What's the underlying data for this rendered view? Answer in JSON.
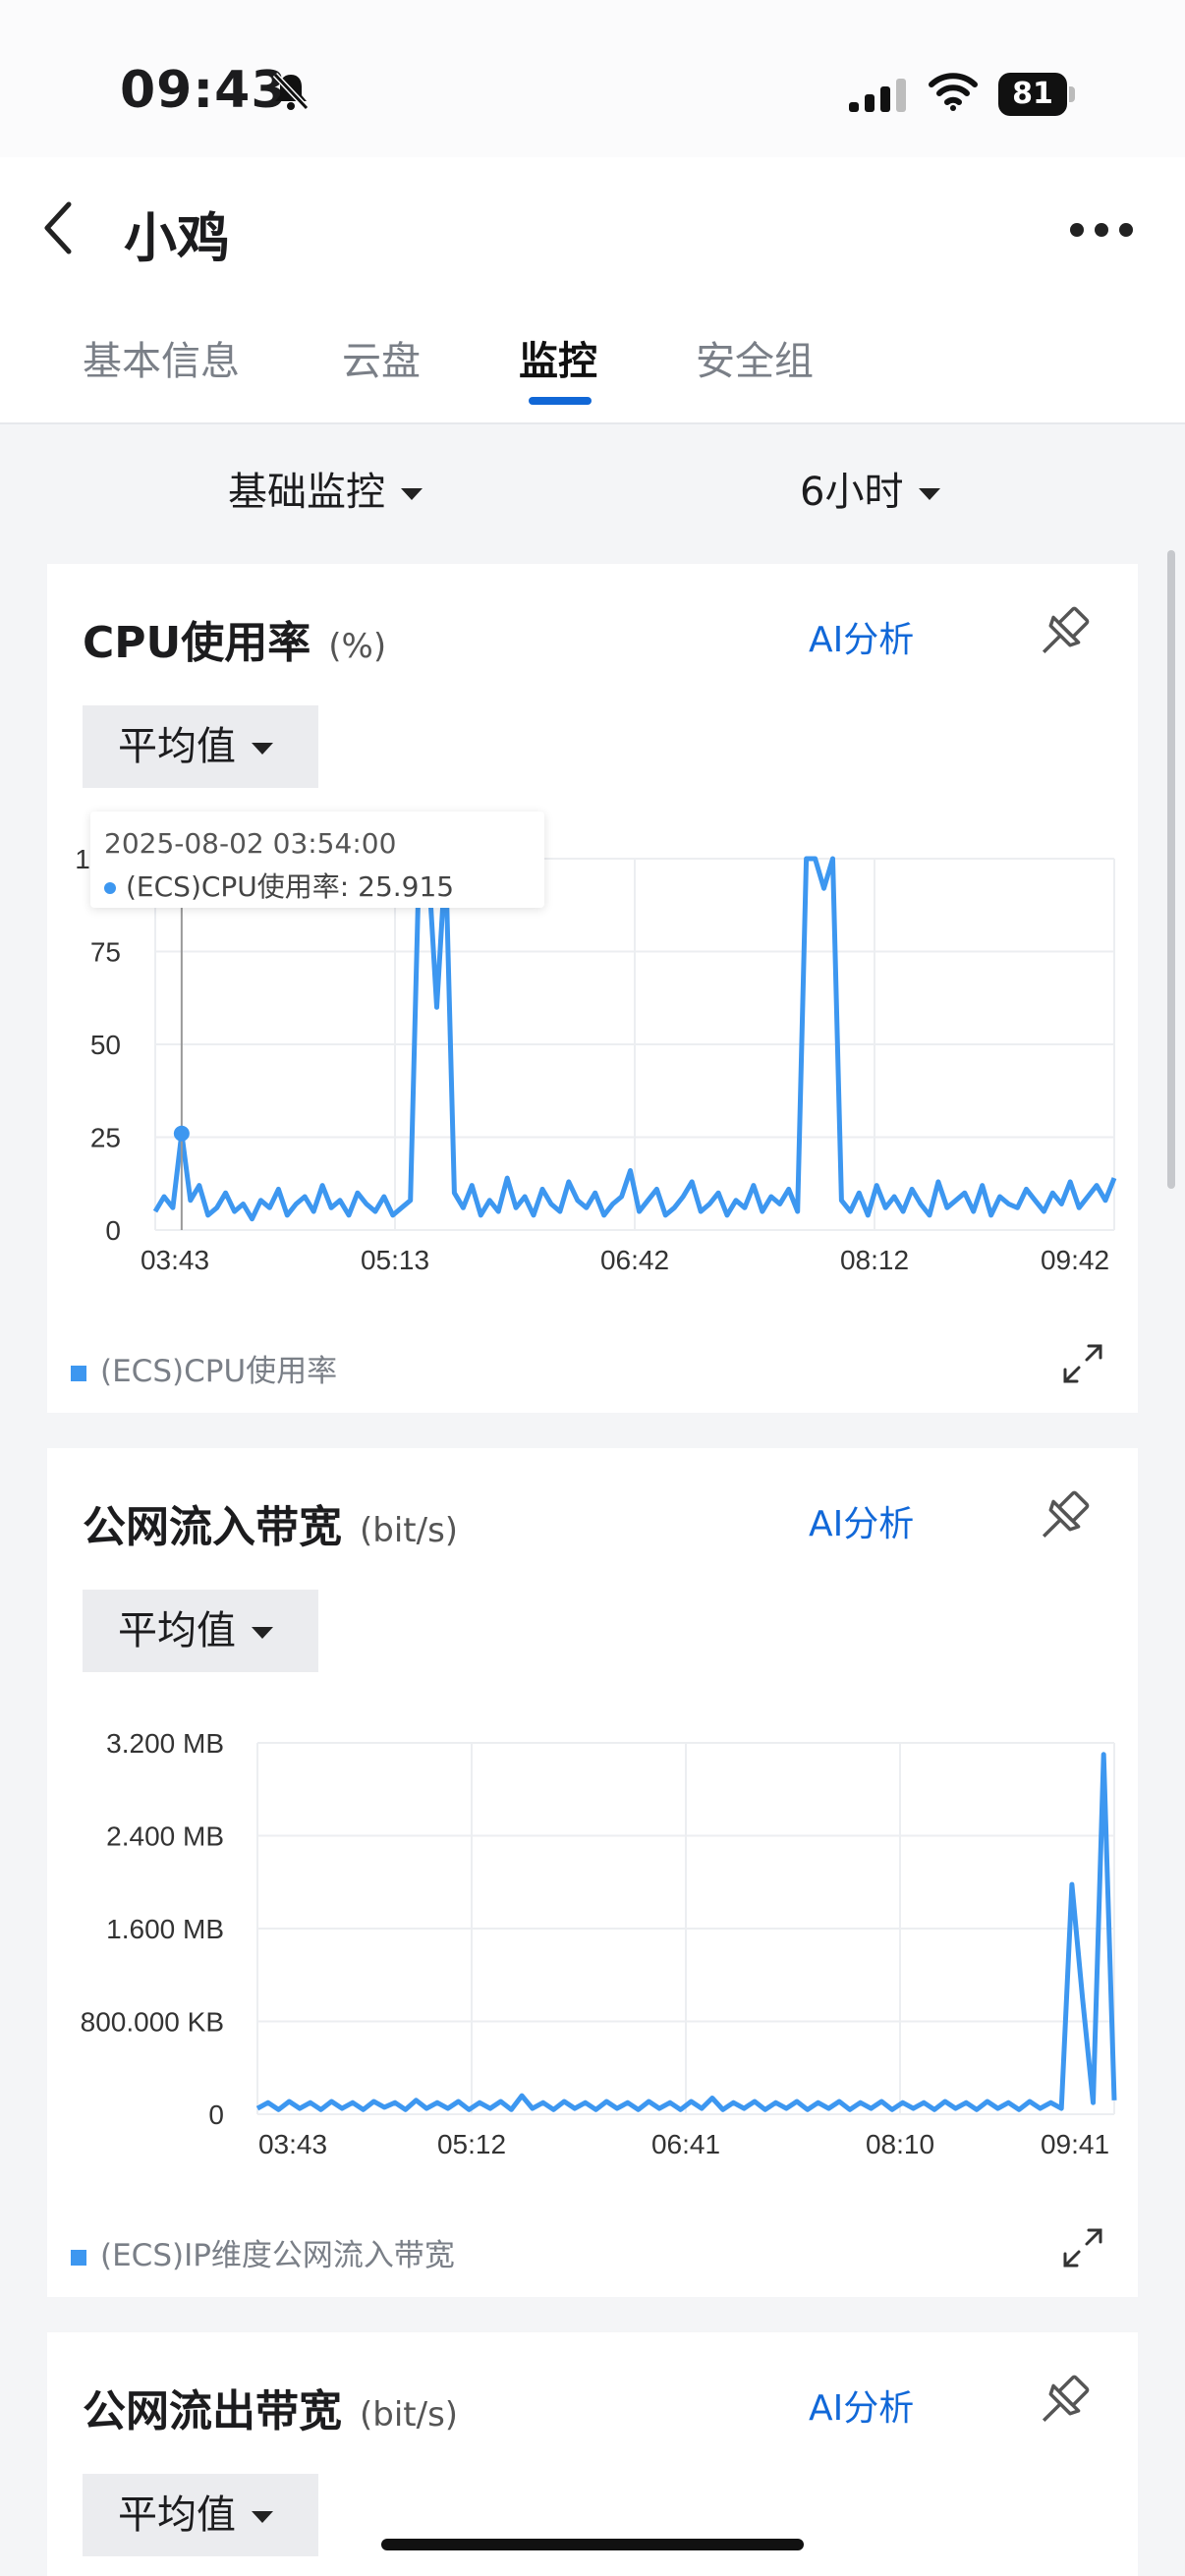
{
  "status_bar": {
    "time": "09:43",
    "battery": "81"
  },
  "header": {
    "title": "小鸡",
    "tabs": [
      "基本信息",
      "云盘",
      "监控",
      "安全组"
    ],
    "active_tab": 2
  },
  "filters": {
    "monitor_type": "基础监控",
    "range": "6小时"
  },
  "colors": {
    "accent": "#1168d8",
    "series": "#3d97f0"
  },
  "charts": [
    {
      "title": "CPU使用率",
      "unit": "(%)",
      "ai_label": "AI分析",
      "aggregate": "平均值",
      "legend": "(ECS)CPU使用率",
      "tooltip": {
        "time": "2025-08-02 03:54:00",
        "label": "(ECS)CPU使用率: 25.915"
      }
    },
    {
      "title": "公网流入带宽",
      "unit": "(bit/s)",
      "ai_label": "AI分析",
      "aggregate": "平均值",
      "legend": "(ECS)IP维度公网流入带宽"
    },
    {
      "title": "公网流出带宽",
      "unit": "(bit/s)",
      "ai_label": "AI分析",
      "aggregate": "平均值"
    }
  ],
  "chart_data": [
    {
      "type": "line",
      "x_ticks": [
        "03:43",
        "05:13",
        "06:42",
        "08:12",
        "09:42"
      ],
      "y_ticks": [
        "100",
        "75",
        "50",
        "25",
        "0"
      ],
      "ylim": [
        0,
        100
      ],
      "grid": true,
      "series": [
        {
          "name": "(ECS)CPU使用率",
          "values": [
            5,
            9,
            6,
            26,
            8,
            12,
            4,
            6,
            10,
            5,
            7,
            3,
            8,
            6,
            11,
            4,
            7,
            9,
            5,
            12,
            6,
            8,
            4,
            10,
            7,
            5,
            9,
            4,
            6,
            8,
            100,
            100,
            60,
            100,
            10,
            6,
            12,
            4,
            8,
            5,
            14,
            6,
            9,
            4,
            11,
            7,
            5,
            13,
            8,
            6,
            10,
            4,
            7,
            9,
            16,
            5,
            8,
            11,
            4,
            6,
            9,
            13,
            5,
            7,
            10,
            4,
            8,
            6,
            12,
            5,
            9,
            7,
            11,
            5,
            100,
            100,
            92,
            100,
            8,
            5,
            10,
            4,
            12,
            6,
            9,
            5,
            11,
            7,
            4,
            13,
            6,
            8,
            10,
            5,
            12,
            4,
            9,
            7,
            6,
            11,
            8,
            5,
            10,
            7,
            13,
            6,
            9,
            12,
            8,
            14
          ]
        }
      ]
    },
    {
      "type": "line",
      "x_ticks": [
        "03:43",
        "05:12",
        "06:41",
        "08:10",
        "09:41"
      ],
      "y_ticks": [
        "3.200 MB",
        "2.400 MB",
        "1.600 MB",
        "800.000 KB",
        "0"
      ],
      "ylim": [
        0,
        3.2
      ],
      "grid": true,
      "series": [
        {
          "name": "(ECS)IP维度公网流入带宽",
          "values": [
            0.05,
            0.1,
            0.04,
            0.11,
            0.05,
            0.1,
            0.04,
            0.11,
            0.05,
            0.1,
            0.04,
            0.11,
            0.06,
            0.1,
            0.04,
            0.12,
            0.05,
            0.1,
            0.05,
            0.11,
            0.04,
            0.1,
            0.05,
            0.11,
            0.04,
            0.16,
            0.05,
            0.1,
            0.04,
            0.11,
            0.05,
            0.1,
            0.04,
            0.11,
            0.05,
            0.1,
            0.04,
            0.11,
            0.05,
            0.1,
            0.04,
            0.11,
            0.05,
            0.14,
            0.04,
            0.1,
            0.05,
            0.11,
            0.04,
            0.1,
            0.05,
            0.11,
            0.04,
            0.1,
            0.05,
            0.11,
            0.04,
            0.1,
            0.05,
            0.11,
            0.04,
            0.1,
            0.05,
            0.1,
            0.04,
            0.11,
            0.05,
            0.1,
            0.04,
            0.11,
            0.05,
            0.1,
            0.04,
            0.11,
            0.05,
            0.1,
            0.05,
            1.98,
            1.0,
            0.1,
            3.1,
            0.12
          ]
        }
      ]
    }
  ]
}
